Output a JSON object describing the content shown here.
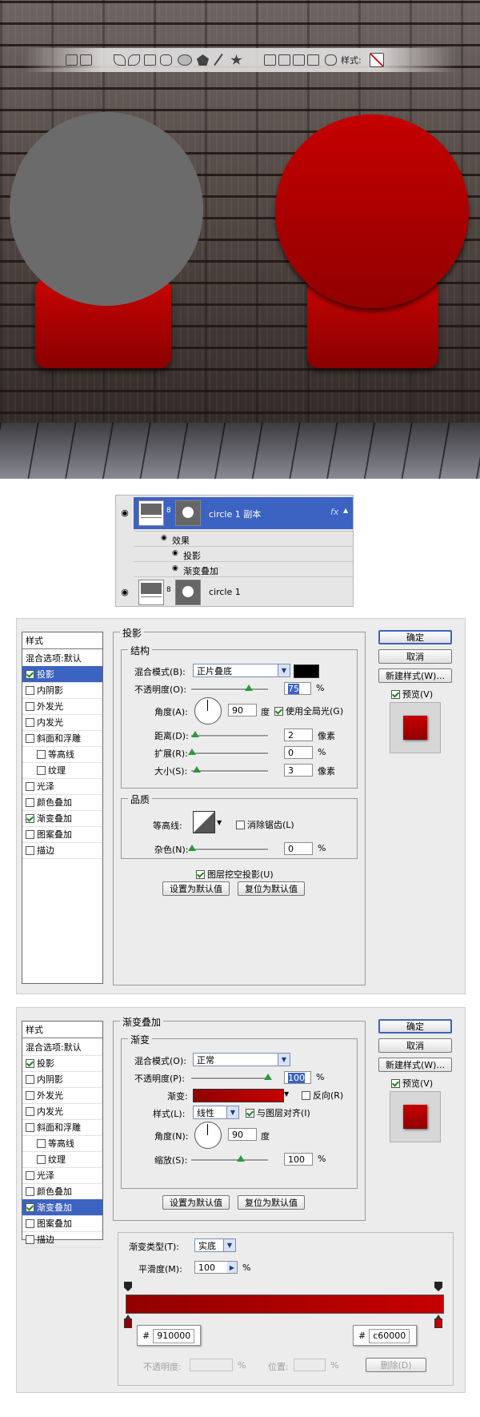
{
  "toolbar": {
    "styles_label": "样式:"
  },
  "layers": {
    "layer1_name": "circle 1 副本",
    "fx_badge": "fx",
    "effects_label": "效果",
    "effect_items": [
      "投影",
      "渐变叠加"
    ],
    "layer2_name": "circle 1"
  },
  "style_list": {
    "header": "样式",
    "items": [
      {
        "label": "混合选项:默认",
        "checkbox": false,
        "checked": false,
        "indent": false
      },
      {
        "label": "投影",
        "checkbox": true,
        "checked": true,
        "indent": false
      },
      {
        "label": "内阴影",
        "checkbox": true,
        "checked": false,
        "indent": false
      },
      {
        "label": "外发光",
        "checkbox": true,
        "checked": false,
        "indent": false
      },
      {
        "label": "内发光",
        "checkbox": true,
        "checked": false,
        "indent": false
      },
      {
        "label": "斜面和浮雕",
        "checkbox": true,
        "checked": false,
        "indent": false
      },
      {
        "label": "等高线",
        "checkbox": true,
        "checked": false,
        "indent": true
      },
      {
        "label": "纹理",
        "checkbox": true,
        "checked": false,
        "indent": true
      },
      {
        "label": "光泽",
        "checkbox": true,
        "checked": false,
        "indent": false
      },
      {
        "label": "颜色叠加",
        "checkbox": true,
        "checked": false,
        "indent": false
      },
      {
        "label": "渐变叠加",
        "checkbox": true,
        "checked": true,
        "indent": false
      },
      {
        "label": "图案叠加",
        "checkbox": true,
        "checked": false,
        "indent": false
      },
      {
        "label": "描边",
        "checkbox": true,
        "checked": false,
        "indent": false
      }
    ]
  },
  "dialog1": {
    "selected_index": 1,
    "group_title": "投影",
    "structure_title": "结构",
    "blend_mode_label": "混合模式(B):",
    "blend_mode_value": "正片叠底",
    "shadow_color": "#000000",
    "opacity_label": "不透明度(O):",
    "opacity_value": "75",
    "opacity_level": 0.75,
    "percent": "%",
    "angle_label": "角度(A):",
    "angle_value": "90",
    "degree_unit": "度",
    "use_global_light": "使用全局光(G)",
    "distance_label": "距离(D):",
    "distance_value": "2",
    "pixel_unit": "像素",
    "spread_label": "扩展(R):",
    "spread_value": "0",
    "size_label": "大小(S):",
    "size_value": "3",
    "quality_title": "品质",
    "contour_label": "等高线:",
    "anti_alias": "消除锯齿(L)",
    "noise_label": "杂色(N):",
    "noise_value": "0",
    "knockout": "图层挖空投影(U)",
    "make_default": "设置为默认值",
    "reset_default": "复位为默认值",
    "ok": "确定",
    "cancel": "取消",
    "new_style": "新建样式(W)...",
    "preview": "预览(V)"
  },
  "dialog2": {
    "selected_index": 10,
    "group_title": "渐变叠加",
    "gradient_title": "渐变",
    "blend_mode_label": "混合模式(O):",
    "blend_mode_value": "正常",
    "opacity_label": "不透明度(P):",
    "opacity_value": "100",
    "opacity_level": 1.0,
    "percent": "%",
    "gradient_label": "渐变:",
    "reverse": "反向(R)",
    "style_label": "样式(L):",
    "style_value": "线性",
    "align_layer": "与图层对齐(I)",
    "angle_label": "角度(N):",
    "angle_value": "90",
    "degree_unit": "度",
    "scale_label": "缩放(S):",
    "scale_value": "100",
    "make_default": "设置为默认值",
    "reset_default": "复位为默认值",
    "ok": "确定",
    "cancel": "取消",
    "new_style": "新建样式(W)...",
    "preview": "预览(V)",
    "gradient_type_label": "渐变类型(T):",
    "gradient_type_value": "实底",
    "smoothness_label": "平滑度(M):",
    "smoothness_value": "100",
    "hash": "#",
    "color_left": "910000",
    "color_right": "c60000",
    "stop_opacity_label": "不透明度:",
    "location_label": "位置:",
    "delete_label": "删除(D)",
    "gradient_start": "#910000",
    "gradient_end": "#c60000"
  }
}
